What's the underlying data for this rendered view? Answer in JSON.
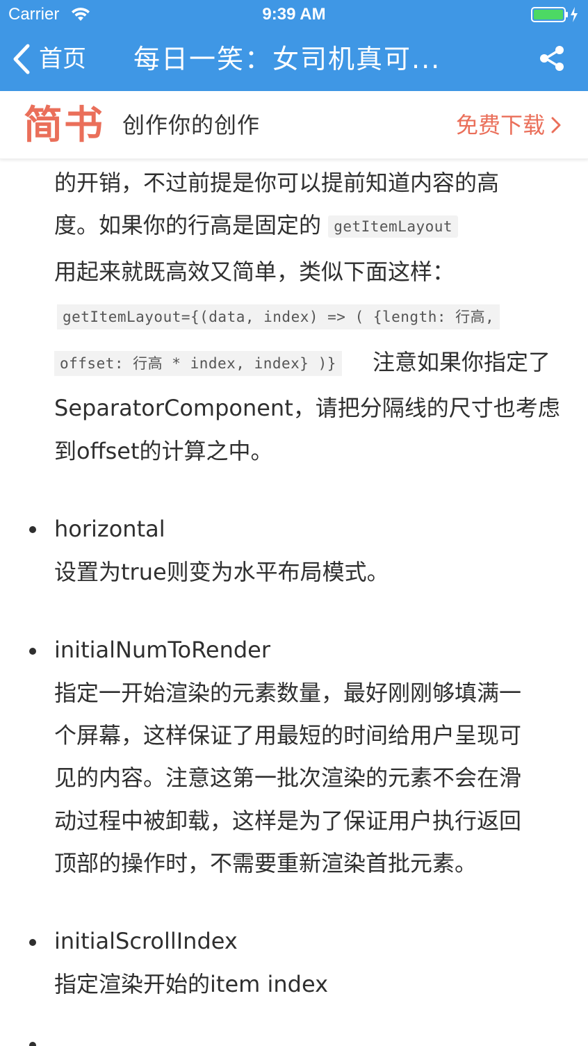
{
  "status_bar": {
    "carrier": "Carrier",
    "time": "9:39 AM"
  },
  "nav_bar": {
    "back_label": "首页",
    "title": "每日一笑：女司机真可...",
    "icons": {
      "back": "chevron-left-icon",
      "share": "share-icon"
    }
  },
  "banner": {
    "logo": "简书",
    "slogan": "创作你的创作",
    "download_label": "免费下载"
  },
  "article": {
    "para1": {
      "line1": "的开销，不过前提是你可以提前知道内容的高",
      "line2_text": "度。如果你的行高是固定的",
      "line2_code": "getItemLayout",
      "line3": "用起来就既高效又简单，类似下面这样：",
      "code1": "getItemLayout={(data, index) => ( {length: 行高,",
      "code2": "offset: 行高 * index, index} )}",
      "line5_text": "注意如果你指定了",
      "line6": "SeparatorComponent，请把分隔线的尺寸也考虑",
      "line7": "到offset的计算之中。"
    },
    "items": [
      {
        "name": "horizontal",
        "lines": [
          "设置为true则变为水平布局模式。"
        ]
      },
      {
        "name": "initialNumToRender",
        "lines": [
          "指定一开始渲染的元素数量，最好刚刚够填满一",
          "个屏幕，这样保证了用最短的时间给用户呈现可",
          "见的内容。注意这第一批次渲染的元素不会在滑",
          "动过程中被卸载，这样是为了保证用户执行返回",
          "顶部的操作时，不需要重新渲染首批元素。"
        ]
      },
      {
        "name": "initialScrollIndex",
        "lines": [
          "指定渲染开始的item index"
        ]
      }
    ]
  },
  "colors": {
    "nav_blue": "#3f97e5",
    "brand_red": "#ea6f5a",
    "text": "#2f2f2f",
    "code_bg": "#f2f2f2",
    "battery_green": "#4cd964"
  }
}
